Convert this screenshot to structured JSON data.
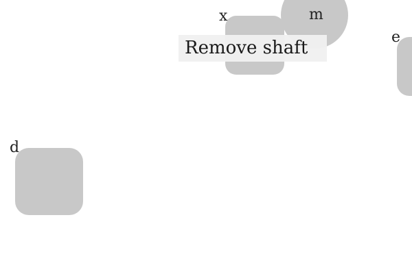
{
  "objects": [
    {
      "id": "x",
      "key_label": "x",
      "shape": "rounded-square"
    },
    {
      "id": "m",
      "key_label": "m",
      "shape": "circle"
    },
    {
      "id": "e",
      "key_label": "e",
      "shape": "rounded-square"
    },
    {
      "id": "d",
      "key_label": "d",
      "shape": "rounded-square"
    }
  ],
  "tooltip": {
    "text": "Remove shaft"
  },
  "colors": {
    "background": "#ffffff",
    "tile": "#c8c8c8",
    "tooltip_background": "#f0f0f0",
    "text": "#1a1a1a"
  }
}
